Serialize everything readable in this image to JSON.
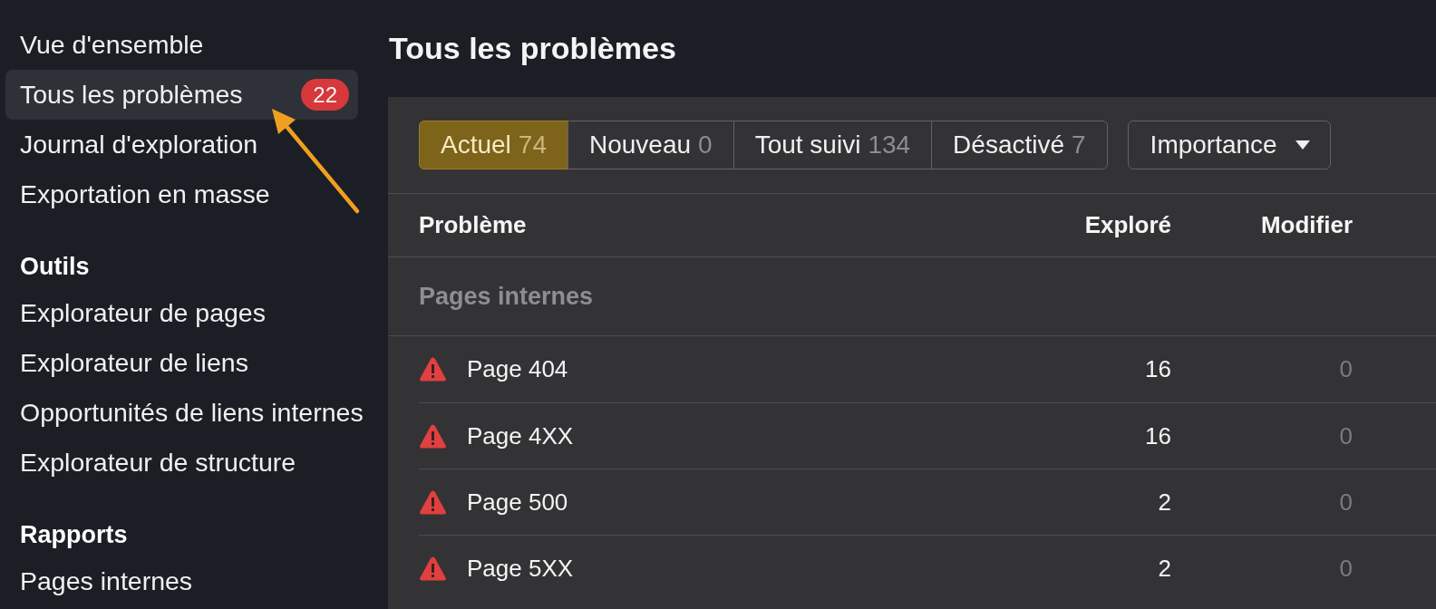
{
  "sidebar": {
    "groups": [
      {
        "items": [
          {
            "label": "Vue d'ensemble",
            "selected": false
          },
          {
            "label": "Tous les problèmes",
            "selected": true,
            "badge": "22"
          },
          {
            "label": "Journal d'exploration",
            "selected": false
          },
          {
            "label": "Exportation en masse",
            "selected": false
          }
        ]
      },
      {
        "heading": "Outils",
        "items": [
          {
            "label": "Explorateur de pages",
            "selected": false
          },
          {
            "label": "Explorateur de liens",
            "selected": false
          },
          {
            "label": "Opportunités de liens internes",
            "selected": false
          },
          {
            "label": "Explorateur de structure",
            "selected": false
          }
        ]
      },
      {
        "heading": "Rapports",
        "items": [
          {
            "label": "Pages internes",
            "selected": false
          }
        ]
      }
    ]
  },
  "page": {
    "title": "Tous les problèmes"
  },
  "filters": {
    "tabs": [
      {
        "label": "Actuel",
        "count": "74",
        "selected": true
      },
      {
        "label": "Nouveau",
        "count": "0",
        "selected": false
      },
      {
        "label": "Tout suivi",
        "count": "134",
        "selected": false
      },
      {
        "label": "Désactivé",
        "count": "7",
        "selected": false
      }
    ],
    "sort_dropdown": {
      "label": "Importance"
    }
  },
  "table": {
    "columns": [
      "Problème",
      "Exploré",
      "Modifier"
    ],
    "groups": [
      {
        "title": "Pages internes",
        "rows": [
          {
            "issue": "Page 404",
            "crawled": "16",
            "changed": "0"
          },
          {
            "issue": "Page 4XX",
            "crawled": "16",
            "changed": "0"
          },
          {
            "issue": "Page 500",
            "crawled": "2",
            "changed": "0"
          },
          {
            "issue": "Page 5XX",
            "crawled": "2",
            "changed": "0"
          }
        ]
      }
    ]
  }
}
